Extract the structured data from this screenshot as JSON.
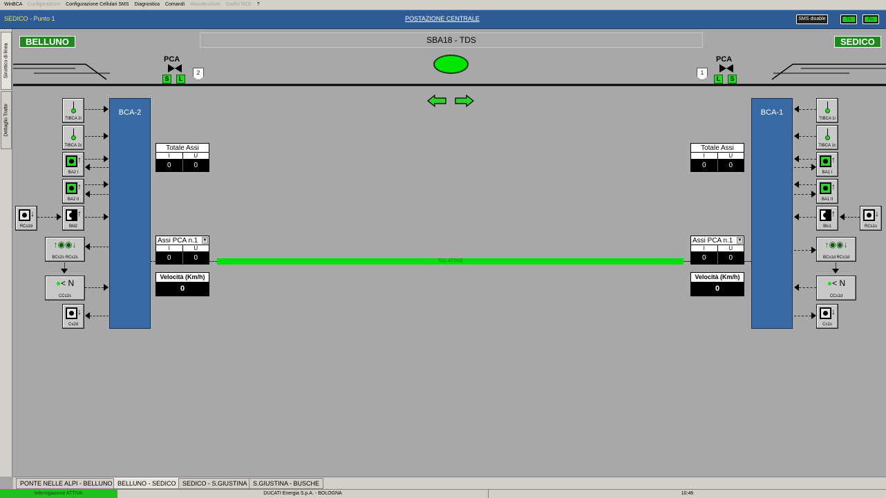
{
  "menu": {
    "items": [
      {
        "label": "WinBCA",
        "disabled": false
      },
      {
        "label": "Configurazione",
        "disabled": true
      },
      {
        "label": "Configurazione Cellulari SMS",
        "disabled": false
      },
      {
        "label": "Diagnostica",
        "disabled": false
      },
      {
        "label": "Comandi",
        "disabled": false
      },
      {
        "label": "Manutenzione",
        "disabled": true
      },
      {
        "label": "Grafici RCE",
        "disabled": true
      },
      {
        "label": "?",
        "disabled": false
      }
    ]
  },
  "header": {
    "left_title": "SEDICO - Punto 1",
    "center_title": "POSTAZIONE CENTRALE",
    "sms_button": "SMS disable",
    "led1": "Tx",
    "led2": "Rx"
  },
  "vtabs": {
    "tab1": "Sinottico di linea",
    "tab2": "Dettaglio Tratte"
  },
  "main": {
    "station_left": "BELLUNO",
    "station_right": "SEDICO",
    "section_title": "SBA18 - TDS",
    "pca_left": "PCA",
    "pca_right": "PCA",
    "left_s": "S",
    "left_l": "L",
    "left_signal": "2",
    "right_s": "S",
    "right_l": "L",
    "right_signal": "1",
    "bca_left": "BCA-2",
    "bca_right": "BCA-1",
    "left_sensors": {
      "tibca2i": "TIBCA 2i",
      "tibca2c": "TIBCA 2c",
      "ba2i": "BA2 I",
      "ba2ii": "BA2 II",
      "bld2": "Bld2",
      "rcs2d": "RCs2d",
      "bcs2s": "BCs2s",
      "rcs2s": "RCs2s",
      "ccs2s": "CCs2s",
      "cs2d": "Cs2d"
    },
    "right_sensors": {
      "tibca1i": "TIBCA 1i",
      "tibca1c": "TIBCA 1c",
      "ba1i": "BA1 I",
      "ba1ii": "BA1 II",
      "bls1": "Bls1",
      "rcs1s": "RCs1s",
      "bcs1d": "BCs1d",
      "rcs1d": "RCs1d",
      "ccs1d": "CCs1d",
      "cs1s": "Cs1s"
    },
    "totale_left": {
      "title": "Totale Assi",
      "i_label": "I",
      "u_label": "U",
      "i_value": "0",
      "u_value": "0"
    },
    "totale_right": {
      "title": "Totale Assi",
      "i_label": "I",
      "u_label": "U",
      "i_value": "0",
      "u_value": "0"
    },
    "assi_left": {
      "title": "Assi PCA n.1",
      "i_label": "I",
      "u_label": "U",
      "i_value": "0",
      "u_value": "0"
    },
    "assi_right": {
      "title": "Assi PCA n.1",
      "i_label": "I",
      "u_label": "U",
      "i_value": "0",
      "u_value": "0"
    },
    "vel_left": {
      "title": "Velocità (Km/h)",
      "value": "0"
    },
    "vel_right": {
      "title": "Velocità (Km/h)",
      "value": "0"
    },
    "tlc": "TLC: ATTIVO"
  },
  "bottom_tabs": [
    {
      "label": "PONTE NELLE ALPI - BELLUNO",
      "selected": false
    },
    {
      "label": "BELLUNO - SEDICO",
      "selected": true
    },
    {
      "label": "SEDICO - S.GIUSTINA",
      "selected": false
    },
    {
      "label": "S.GIUSTINA - BUSCHE",
      "selected": false
    }
  ],
  "status": {
    "left": "Interrogazione ATTIVA",
    "center": "DUCATI Energia S.p.A. - BOLOGNA",
    "time": "10:46"
  },
  "colors": {
    "panel": "#a8a8a8",
    "header": "#2e5a95",
    "bca": "#3a6aa6",
    "led_green": "#00e000"
  }
}
